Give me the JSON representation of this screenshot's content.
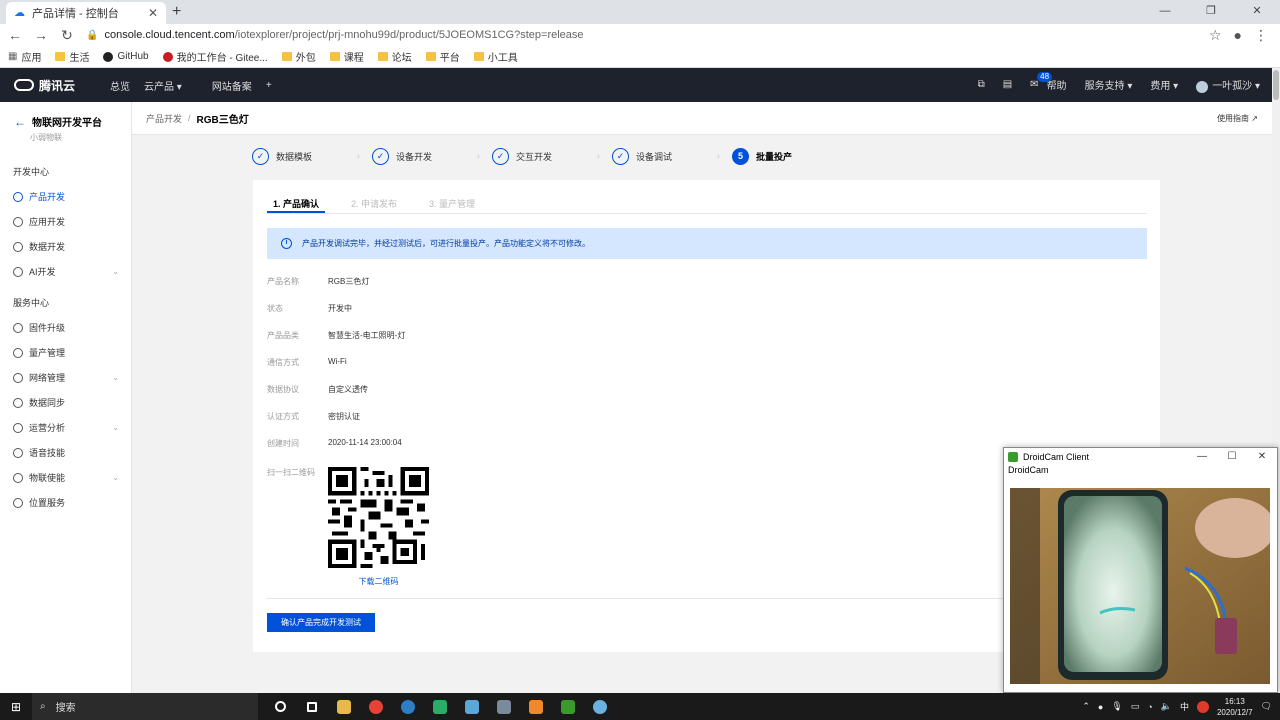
{
  "browser": {
    "tab_title": "产品详情 - 控制台",
    "url_host": "console.cloud.tencent.com",
    "url_path": "/iotexplorer/project/prj-mnohu99d/product/5JOEOMS1CG?step=release",
    "bookmarks": [
      "应用",
      "生活",
      "GitHub",
      "我的工作台 - Gitee...",
      "外包",
      "课程",
      "论坛",
      "平台",
      "小工具"
    ]
  },
  "topnav": {
    "brand": "腾讯云",
    "items": [
      "总览",
      "云产品 ▾",
      "网站备案",
      "+"
    ],
    "mail_badge": "48",
    "help": "帮助",
    "support": "服务支持 ▾",
    "billing": "费用 ▾",
    "user": "一叶孤沙 ▾"
  },
  "sidebar": {
    "back_title": "物联网开发平台",
    "subtitle": "小弱物联",
    "group1": "开发中心",
    "dev_items": [
      {
        "label": "产品开发",
        "icon": "gear-icon"
      },
      {
        "label": "应用开发",
        "icon": "app-icon"
      },
      {
        "label": "数据开发",
        "icon": "data-icon"
      },
      {
        "label": "AI开发",
        "icon": "ai-icon"
      }
    ],
    "group2": "服务中心",
    "svc_items": [
      {
        "label": "固件升级",
        "icon": "firmware-icon"
      },
      {
        "label": "量产管理",
        "icon": "production-icon"
      },
      {
        "label": "网络管理",
        "icon": "network-icon"
      },
      {
        "label": "数据同步",
        "icon": "sync-icon"
      },
      {
        "label": "运营分析",
        "icon": "analytics-icon"
      },
      {
        "label": "语音技能",
        "icon": "voice-icon"
      },
      {
        "label": "物联使能",
        "icon": "iot-icon"
      },
      {
        "label": "位置服务",
        "icon": "location-icon"
      }
    ]
  },
  "breadcrumb": {
    "parent": "产品开发",
    "current": "RGB三色灯",
    "guide": "使用指南"
  },
  "steps": [
    {
      "label": "数据模板",
      "mark": "✓"
    },
    {
      "label": "设备开发",
      "mark": "✓"
    },
    {
      "label": "交互开发",
      "mark": "✓"
    },
    {
      "label": "设备调试",
      "mark": "✓"
    },
    {
      "label": "批量投产",
      "mark": "5"
    }
  ],
  "subtabs": [
    "1. 产品确认",
    "2. 申请发布",
    "3. 量产管理"
  ],
  "notice": "产品开发调试完毕，并经过测试后，可进行批量投产。产品功能定义将不可修改。",
  "fields": [
    {
      "label": "产品名称",
      "value": "RGB三色灯"
    },
    {
      "label": "状态",
      "value": "开发中"
    },
    {
      "label": "产品品类",
      "value": "智慧生活-电工照明-灯"
    },
    {
      "label": "通信方式",
      "value": "Wi-Fi"
    },
    {
      "label": "数据协议",
      "value": "自定义透传"
    },
    {
      "label": "认证方式",
      "value": "密钥认证"
    },
    {
      "label": "创建时间",
      "value": "2020-11-14 23:00:04"
    }
  ],
  "qr": {
    "label": "扫一扫二维码",
    "download": "下载二维码"
  },
  "confirm_button": "确认产品完成开发测试",
  "droidcam": {
    "title": "DroidCam Client",
    "menu": "DroidCam"
  },
  "taskbar": {
    "search": "搜索",
    "time": "16:13",
    "date": "2020/12/7",
    "ime": "中"
  }
}
